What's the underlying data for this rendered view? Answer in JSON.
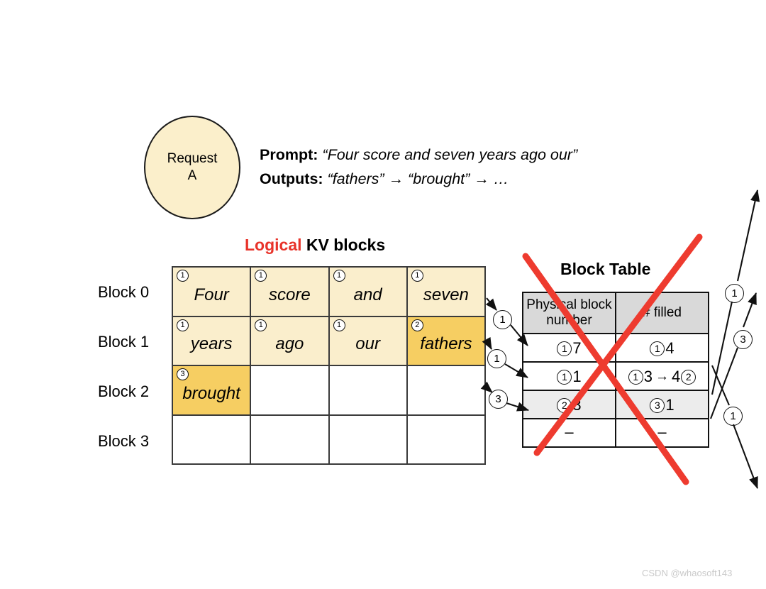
{
  "request": {
    "line1": "Request",
    "line2": "A"
  },
  "prompt": {
    "prompt_label": "Prompt:",
    "prompt_text": "“Four score and seven years ago our”",
    "outputs_label": "Outputs:",
    "outputs_text": "“fathers” → “brought” → …"
  },
  "logical": {
    "heading_red": "Logical",
    "heading_rest": " KV blocks",
    "row_labels": [
      "Block 0",
      "Block 1",
      "Block 2",
      "Block 3"
    ],
    "cells": [
      [
        {
          "badge": "1",
          "token": "Four",
          "fill": "light"
        },
        {
          "badge": "1",
          "token": "score",
          "fill": "light"
        },
        {
          "badge": "1",
          "token": "and",
          "fill": "light"
        },
        {
          "badge": "1",
          "token": "seven",
          "fill": "light"
        }
      ],
      [
        {
          "badge": "1",
          "token": "years",
          "fill": "light"
        },
        {
          "badge": "1",
          "token": "ago",
          "fill": "light"
        },
        {
          "badge": "1",
          "token": "our",
          "fill": "light"
        },
        {
          "badge": "2",
          "token": "fathers",
          "fill": "dark"
        }
      ],
      [
        {
          "badge": "3",
          "token": "brought",
          "fill": "dark"
        },
        {
          "badge": "",
          "token": "",
          "fill": "none"
        },
        {
          "badge": "",
          "token": "",
          "fill": "none"
        },
        {
          "badge": "",
          "token": "",
          "fill": "none"
        }
      ],
      [
        {
          "badge": "",
          "token": "",
          "fill": "none"
        },
        {
          "badge": "",
          "token": "",
          "fill": "none"
        },
        {
          "badge": "",
          "token": "",
          "fill": "none"
        },
        {
          "badge": "",
          "token": "",
          "fill": "none"
        }
      ]
    ]
  },
  "block_table": {
    "heading": "Block Table",
    "columns": [
      "Physical block number",
      "# filled"
    ],
    "rows": [
      {
        "shaded": false,
        "phys_badge": "1",
        "phys_value": "7",
        "filled_badge": "1",
        "filled_value": "4",
        "filled_arrow": "",
        "filled_value2": "",
        "filled_badge2": ""
      },
      {
        "shaded": false,
        "phys_badge": "1",
        "phys_value": "1",
        "filled_badge": "1",
        "filled_value": "3",
        "filled_arrow": "→",
        "filled_value2": "4",
        "filled_badge2": "2"
      },
      {
        "shaded": true,
        "phys_badge": "2",
        "phys_value": "3",
        "filled_badge": "3",
        "filled_value": "1",
        "filled_arrow": "",
        "filled_value2": "",
        "filled_badge2": ""
      },
      {
        "shaded": false,
        "phys_badge": "",
        "phys_value": "–",
        "filled_badge": "",
        "filled_value": "–",
        "filled_arrow": "",
        "filled_value2": "",
        "filled_badge2": ""
      }
    ]
  },
  "mapping_arrows": [
    {
      "label": "1"
    },
    {
      "label": "1"
    },
    {
      "label": "3"
    }
  ],
  "outgoing_arrows": [
    {
      "label": "1"
    },
    {
      "label": "3"
    },
    {
      "label": "1"
    }
  ],
  "annotation": {
    "strike_color": "#EE3B2F",
    "note": "red X over Block Table"
  },
  "watermark": {
    "text": "CSDN @whaosoft143"
  },
  "colors": {
    "cell_light": "#FAEECC",
    "cell_dark": "#F6CE62",
    "circle_fill": "#FBEFCB",
    "header_grey": "#D9D9D9",
    "row_grey": "#ECECEC",
    "logical_red": "#E8332A",
    "strike_red": "#EE3B2F"
  }
}
